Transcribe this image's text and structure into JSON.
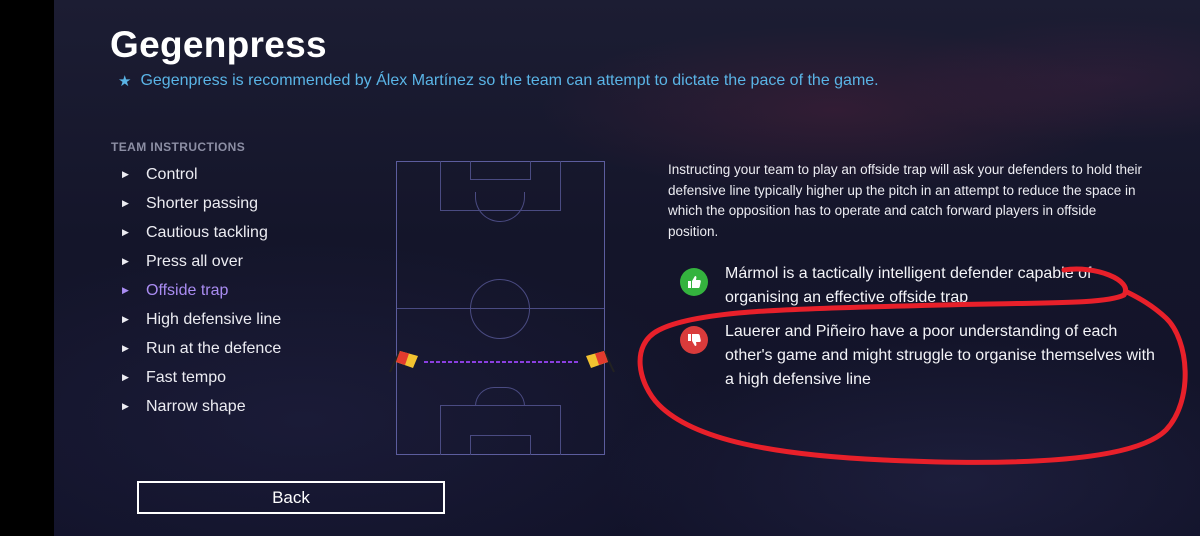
{
  "page": {
    "title": "Gegenpress",
    "subtitle": "Gegenpress is recommended by Álex Martínez so the team can attempt to dictate the pace of the game.",
    "subtitle_icon": "star-icon"
  },
  "instructions": {
    "header": "TEAM INSTRUCTIONS",
    "items": [
      {
        "label": "Control"
      },
      {
        "label": "Shorter passing"
      },
      {
        "label": "Cautious tackling"
      },
      {
        "label": "Press all over"
      },
      {
        "label": "Offside trap",
        "selected": true
      },
      {
        "label": "High defensive line"
      },
      {
        "label": "Run at the defence"
      },
      {
        "label": "Fast tempo"
      },
      {
        "label": "Narrow shape"
      }
    ]
  },
  "detail": {
    "description": "Instructing your team to play an offside trap will ask your defenders to hold their defensive line typically higher up the pitch in an attempt to reduce the space in which the opposition has to operate and catch forward players in offside position.",
    "positive": {
      "icon": "thumbs-up-icon",
      "text": "Mármol is a tactically intelligent defender capable of organising an effective offside trap"
    },
    "negative": {
      "icon": "thumbs-down-icon",
      "text": "Lauerer and Piñeiro have a poor understanding of each other's game and might struggle to organise themselves with a high defensive line"
    }
  },
  "actions": {
    "back_label": "Back"
  },
  "colors": {
    "accent_selected": "#a98cf2",
    "subtitle_blue": "#5ab4e6",
    "positive_green": "#34b33e",
    "negative_red": "#d93b3b",
    "offside_line": "#8a3fe0",
    "annotation_red": "#e8202a"
  }
}
